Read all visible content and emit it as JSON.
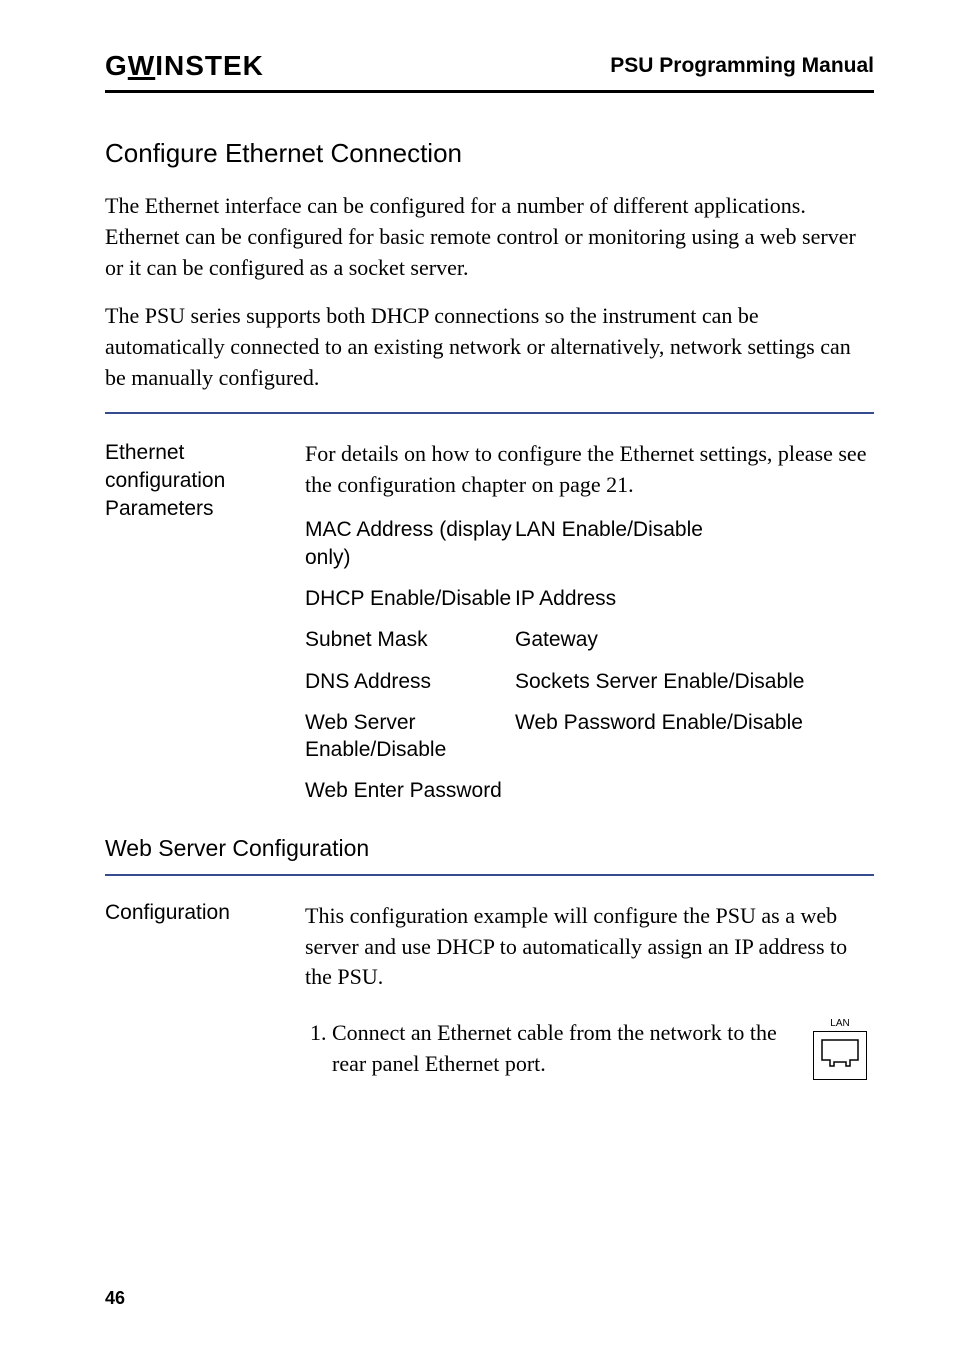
{
  "header": {
    "logo_pre": "G",
    "logo_u": "W",
    "logo_post": "INSTEK",
    "title": "PSU Programming Manual"
  },
  "section1": {
    "title": "Configure Ethernet Connection",
    "para1": "The Ethernet interface can be configured for a number of different applications. Ethernet can be configured for basic remote control or monitoring using a web server or it can be configured as a socket server.",
    "para2": "The PSU series supports both DHCP connections so the instrument can be automatically connected to an existing network or alternatively, network settings can be manually configured."
  },
  "params": {
    "label": "Ethernet configuration Parameters",
    "intro": "For details on how to configure the Ethernet settings, please see the configuration chapter on page 21.",
    "rows": [
      {
        "left": "MAC Address (display only)",
        "right": "LAN Enable/Disable"
      },
      {
        "left": "DHCP Enable/Disable",
        "right": "IP Address"
      },
      {
        "left": "Subnet Mask",
        "right": "Gateway"
      },
      {
        "left": "DNS Address",
        "right": "Sockets Server Enable/Disable"
      },
      {
        "left": "Web Server Enable/Disable",
        "right": "Web Password Enable/Disable"
      }
    ],
    "full_row": "Web Enter Password"
  },
  "section2": {
    "title": "Web Server Configuration"
  },
  "config": {
    "label": "Configuration",
    "intro": "This configuration example will configure the PSU as a web server and use DHCP to automatically assign an IP address to the PSU.",
    "step1": "1.  Connect an Ethernet cable from the network to the rear panel Ethernet port.",
    "lan_label": "LAN"
  },
  "page_number": "46"
}
